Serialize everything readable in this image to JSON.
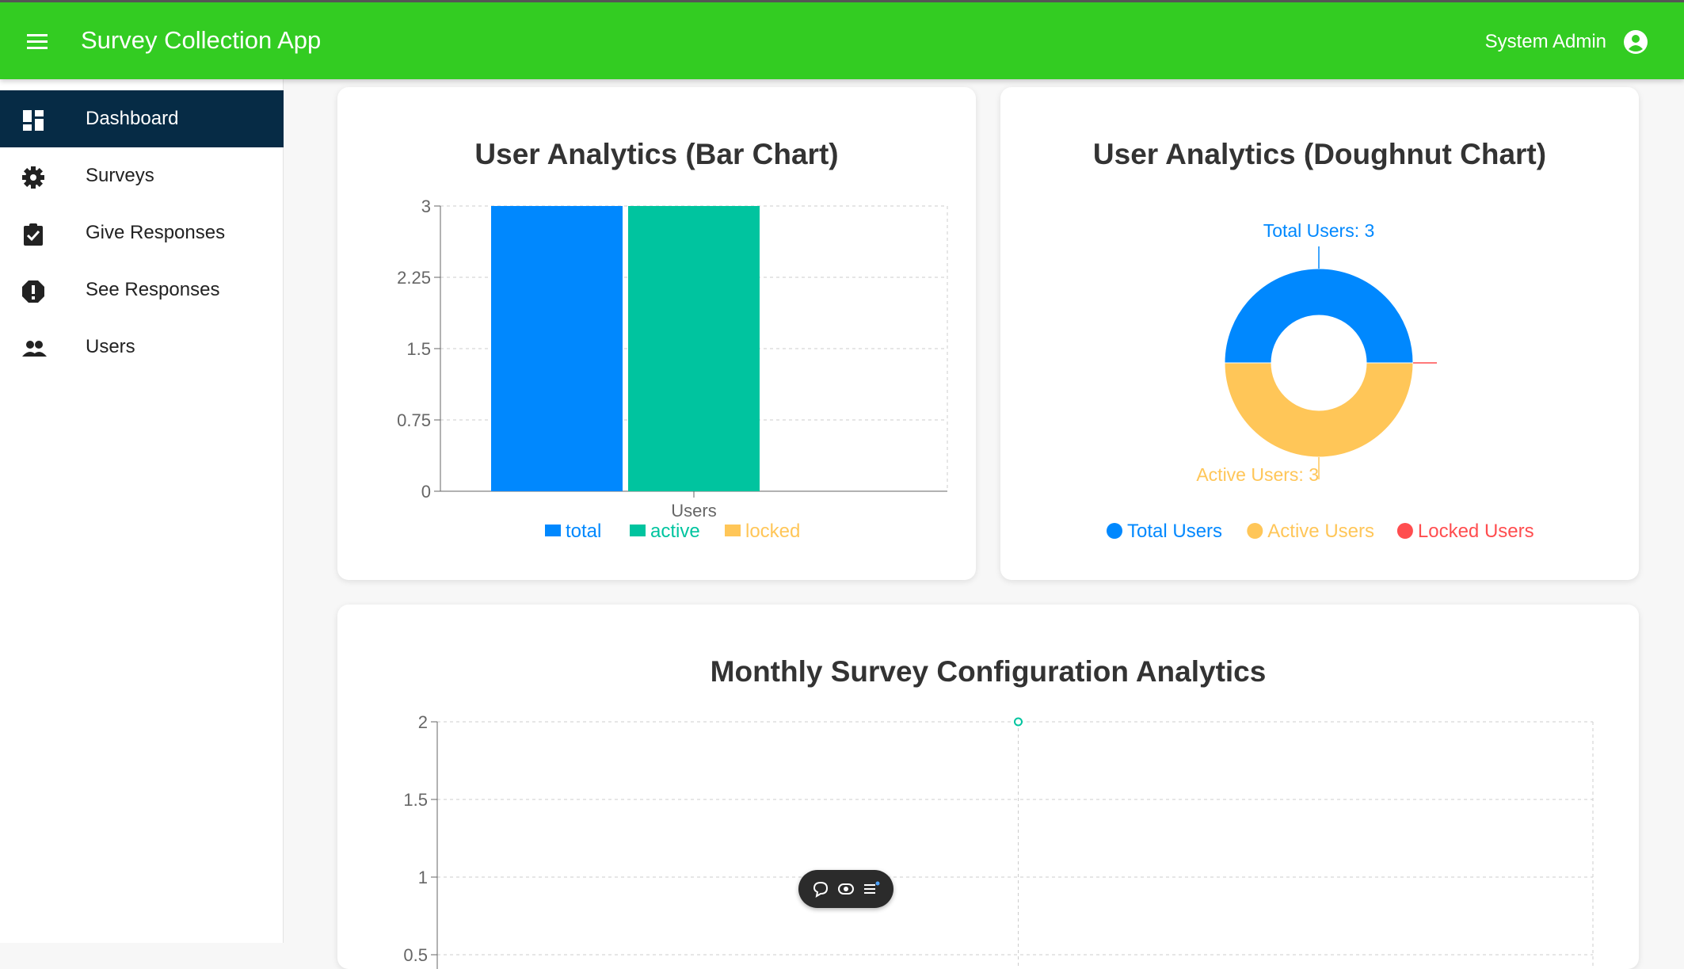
{
  "appbar": {
    "title": "Survey Collection App",
    "user_name": "System Admin",
    "menu_icon": "menu-icon",
    "account_icon": "account-circle-icon",
    "color": "#33cc22"
  },
  "sidebar": {
    "items": [
      {
        "label": "Dashboard",
        "icon": "dashboard-icon",
        "active": true
      },
      {
        "label": "Surveys",
        "icon": "gear-icon",
        "active": false
      },
      {
        "label": "Give Responses",
        "icon": "clipboard-check-icon",
        "active": false
      },
      {
        "label": "See Responses",
        "icon": "alert-icon",
        "active": false
      },
      {
        "label": "Users",
        "icon": "people-icon",
        "active": false
      }
    ],
    "active_color": "#062b45"
  },
  "bar_card": {
    "title": "User Analytics (Bar Chart)"
  },
  "doughnut_card": {
    "title": "User Analytics (Doughnut Chart)",
    "label_total": "Total Users: 3",
    "label_active": "Active Users: 3"
  },
  "monthly_card": {
    "title": "Monthly Survey Configuration Analytics"
  },
  "colors": {
    "total": "#0088fe",
    "active": "#00c49f",
    "locked": "#ffc658",
    "locked_users": "#ff4d4f"
  },
  "chart_data": [
    {
      "type": "bar",
      "title": "User Analytics (Bar Chart)",
      "categories": [
        "Users"
      ],
      "series": [
        {
          "name": "total",
          "values": [
            3
          ]
        },
        {
          "name": "active",
          "values": [
            3
          ]
        },
        {
          "name": "locked",
          "values": [
            0
          ]
        }
      ],
      "ylim": [
        0,
        3
      ],
      "yticks": [
        "3",
        "2.25",
        "1.5",
        "0.75",
        "0"
      ],
      "grid": true,
      "legend": "bottom"
    },
    {
      "type": "pie",
      "subtype": "doughnut",
      "title": "User Analytics (Doughnut Chart)",
      "labels": [
        "Total Users",
        "Active Users",
        "Locked Users"
      ],
      "values": [
        3,
        3,
        0
      ],
      "legend": "bottom"
    },
    {
      "type": "line",
      "title": "Monthly Survey Configuration Analytics",
      "points": [
        {
          "x_index": 1,
          "y": 2
        }
      ],
      "ylim": [
        0,
        2
      ],
      "yticks_visible": [
        "2",
        "1.5",
        "1",
        "0.5"
      ],
      "grid": true
    }
  ],
  "floating_toolbar": {
    "icons": [
      "chat-icon",
      "eye-icon",
      "list-icon"
    ]
  }
}
